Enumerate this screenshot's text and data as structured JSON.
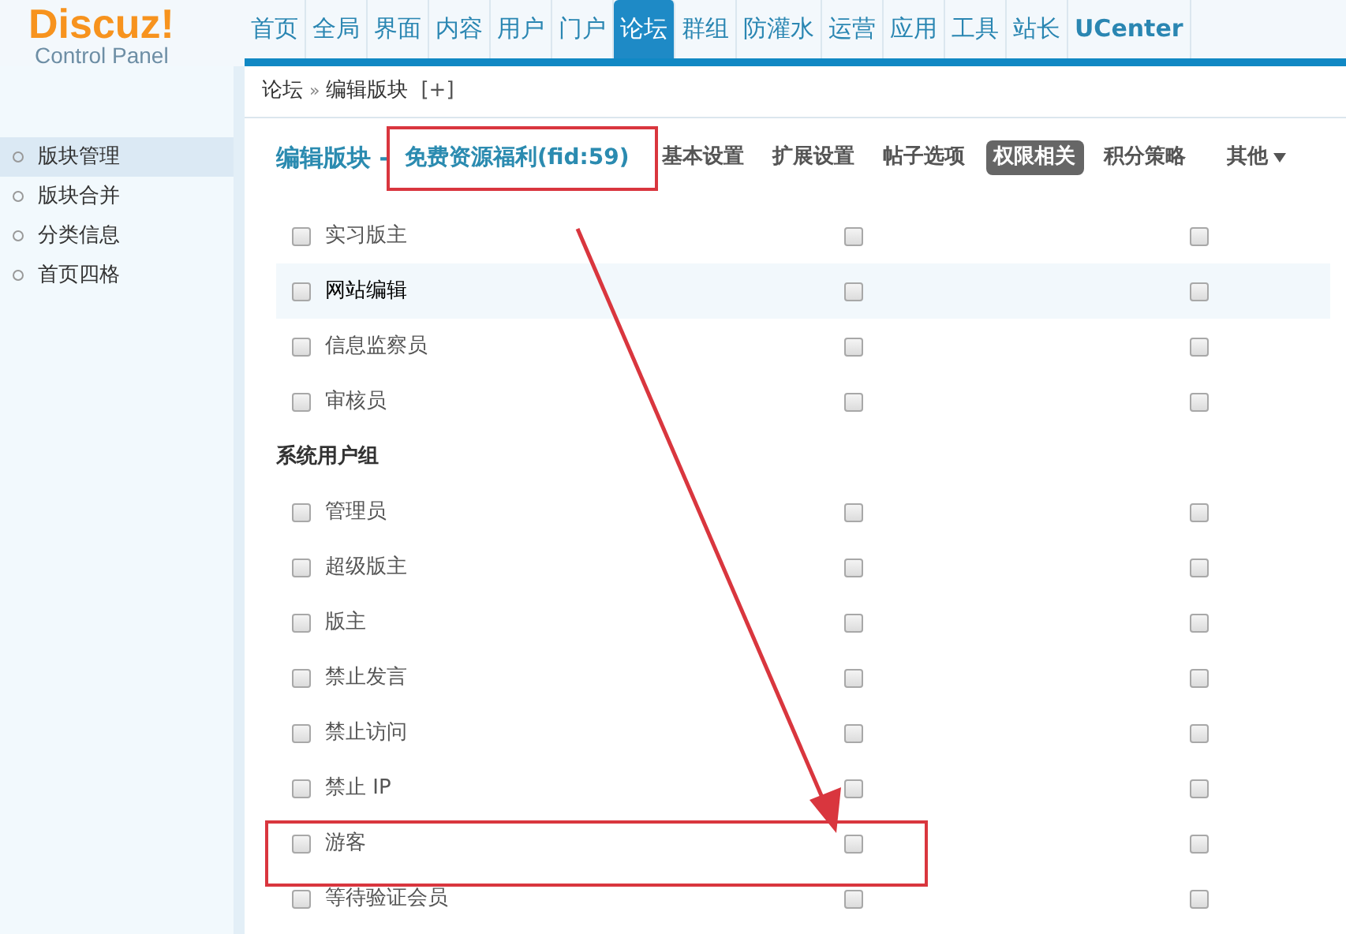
{
  "logo": {
    "title": "Discuz!",
    "subtitle": "Control Panel"
  },
  "nav": [
    {
      "label": "首页",
      "selected": false
    },
    {
      "label": "全局",
      "selected": false
    },
    {
      "label": "界面",
      "selected": false
    },
    {
      "label": "内容",
      "selected": false
    },
    {
      "label": "用户",
      "selected": false
    },
    {
      "label": "门户",
      "selected": false
    },
    {
      "label": "论坛",
      "selected": true
    },
    {
      "label": "群组",
      "selected": false
    },
    {
      "label": "防灌水",
      "selected": false
    },
    {
      "label": "运营",
      "selected": false
    },
    {
      "label": "应用",
      "selected": false
    },
    {
      "label": "工具",
      "selected": false
    },
    {
      "label": "站长",
      "selected": false
    },
    {
      "label": "UCenter",
      "selected": false
    }
  ],
  "breadcrumb": {
    "parent": "论坛",
    "separator": "»",
    "current": "编辑版块",
    "add": "[+]"
  },
  "sidebar": {
    "items": [
      {
        "label": "版块管理",
        "selected": true
      },
      {
        "label": "版块合并",
        "selected": false
      },
      {
        "label": "分类信息",
        "selected": false
      },
      {
        "label": "首页四格",
        "selected": false
      }
    ]
  },
  "page": {
    "title": "编辑版块",
    "dash": "-",
    "forum": "免费资源福利(fid:59)"
  },
  "tabs": [
    {
      "label": "基本设置",
      "selected": false
    },
    {
      "label": "扩展设置",
      "selected": false
    },
    {
      "label": "帖子选项",
      "selected": false
    },
    {
      "label": "权限相关",
      "selected": true
    },
    {
      "label": "积分策略",
      "selected": false
    },
    {
      "label": "其他",
      "selected": false,
      "dropdown": true
    }
  ],
  "rows": [
    {
      "kind": "group",
      "label": "实习版主",
      "highlighted": false,
      "checks": [
        false,
        false,
        false
      ]
    },
    {
      "kind": "group",
      "label": "网站编辑",
      "highlighted": true,
      "checks": [
        false,
        false,
        false
      ]
    },
    {
      "kind": "group",
      "label": "信息监察员",
      "highlighted": false,
      "checks": [
        false,
        false,
        false
      ]
    },
    {
      "kind": "group",
      "label": "审核员",
      "highlighted": false,
      "checks": [
        false,
        false,
        false
      ]
    },
    {
      "kind": "heading",
      "label": "系统用户组"
    },
    {
      "kind": "group",
      "label": "管理员",
      "highlighted": false,
      "checks": [
        false,
        false,
        false
      ]
    },
    {
      "kind": "group",
      "label": "超级版主",
      "highlighted": false,
      "checks": [
        false,
        false,
        false
      ]
    },
    {
      "kind": "group",
      "label": "版主",
      "highlighted": false,
      "checks": [
        false,
        false,
        false
      ]
    },
    {
      "kind": "group",
      "label": "禁止发言",
      "highlighted": false,
      "checks": [
        false,
        false,
        false
      ]
    },
    {
      "kind": "group",
      "label": "禁止访问",
      "highlighted": false,
      "checks": [
        false,
        false,
        false
      ]
    },
    {
      "kind": "group",
      "label": "禁止 IP",
      "highlighted": false,
      "checks": [
        false,
        false,
        false
      ]
    },
    {
      "kind": "group",
      "label": "游客",
      "highlighted": false,
      "checks": [
        false,
        false,
        false
      ]
    },
    {
      "kind": "group",
      "label": "等待验证会员",
      "highlighted": false,
      "checks": [
        false,
        false,
        false
      ]
    }
  ]
}
